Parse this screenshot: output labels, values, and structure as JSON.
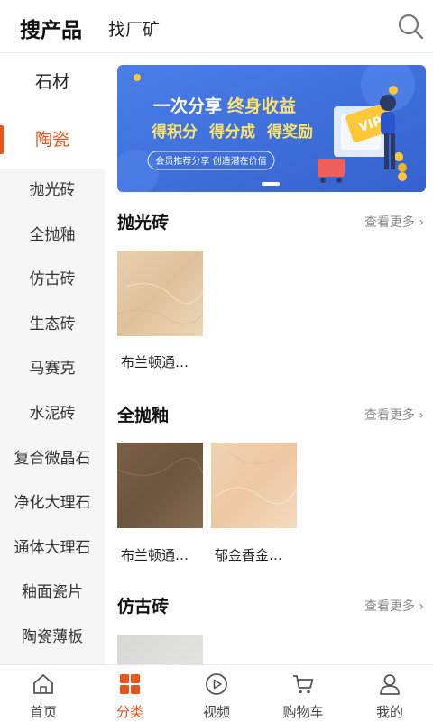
{
  "header": {
    "tab_active": "搜产品",
    "tab_other": "找厂矿"
  },
  "sidebar": {
    "parent": "石材",
    "active": "陶瓷",
    "items": [
      "抛光砖",
      "全抛釉",
      "仿古砖",
      "生态砖",
      "马赛克",
      "水泥砖",
      "复合微晶石",
      "净化大理石",
      "通体大理石",
      "釉面瓷片",
      "陶瓷薄板"
    ]
  },
  "banner": {
    "headline_1": "一次分享",
    "headline_2": "终身收益",
    "line_1": "得积分",
    "line_2": "得分成",
    "line_3": "得奖励",
    "subtitle": "会员推荐分享 创造潜在价值",
    "badge": "VIP"
  },
  "sections": [
    {
      "title": "抛光砖",
      "more": "查看更多",
      "products": [
        {
          "name": "布兰顿通…"
        }
      ]
    },
    {
      "title": "全抛釉",
      "more": "查看更多",
      "products": [
        {
          "name": "布兰顿通…"
        },
        {
          "name": "郁金香金…"
        }
      ]
    },
    {
      "title": "仿古砖",
      "more": "查看更多",
      "products": []
    }
  ],
  "bottom_nav": [
    {
      "label": "首页",
      "icon": "home-icon"
    },
    {
      "label": "分类",
      "icon": "category-icon"
    },
    {
      "label": "视频",
      "icon": "video-icon"
    },
    {
      "label": "购物车",
      "icon": "cart-icon"
    },
    {
      "label": "我的",
      "icon": "profile-icon"
    }
  ],
  "colors": {
    "accent": "#e8541e",
    "banner_bg": "#3f6fd9",
    "highlight_yellow": "#ffe46b"
  }
}
